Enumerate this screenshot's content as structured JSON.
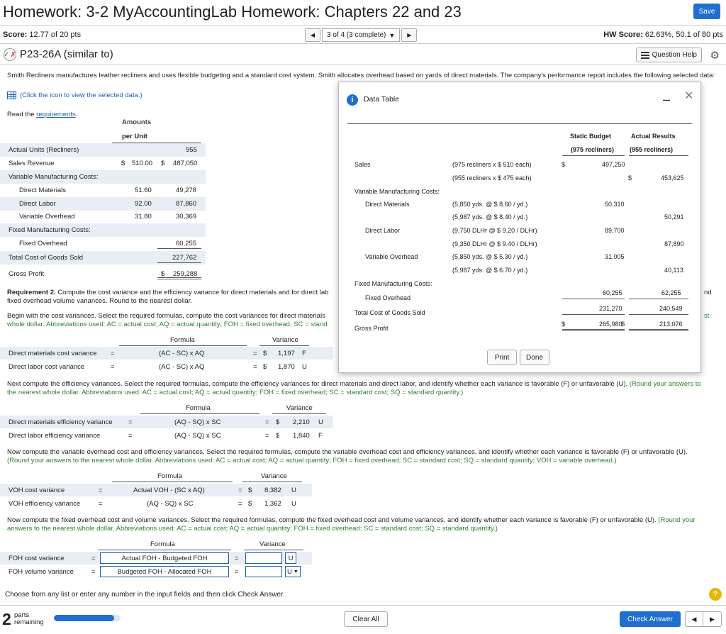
{
  "header": {
    "title": "Homework: 3-2 MyAccountingLab Homework: Chapters 22 and 23",
    "save_label": "Save",
    "score_label": "Score:",
    "score_value": "12.77 of 20 pts",
    "nav_position": "3 of 4 (3 complete)",
    "hw_score_label": "HW Score:",
    "hw_score_value": "62.63%, 50.1 of 80 pts"
  },
  "question": {
    "title": "P23-26A (similar to)",
    "help_label": "Question Help",
    "intro": "Smith Recliners manufactures leather recliners and uses flexible budgeting and a standard cost system. Smith allocates overhead based on yards of direct materials. The company's performance report includes the following selected data:",
    "click_icon_text": "(Click the icon to view the selected data.)",
    "read_prefix": "Read the ",
    "read_link": "requirements",
    "read_suffix": "."
  },
  "left_table": {
    "header1": "Amounts",
    "header2": "per Unit",
    "rows": [
      {
        "label": "Actual Units (Recliners)",
        "per_unit": "",
        "amount": "955"
      },
      {
        "label": "Sales Revenue",
        "per_unit": "$    510.00",
        "amount": "$    487,050"
      },
      {
        "label": "Variable Manufacturing Costs:",
        "per_unit": "",
        "amount": ""
      },
      {
        "label": "Direct Materials",
        "per_unit": "51.60",
        "amount": "49,278"
      },
      {
        "label": "Direct Labor",
        "per_unit": "92.00",
        "amount": "87,860"
      },
      {
        "label": "Variable Overhead",
        "per_unit": "31.80",
        "amount": "30,369"
      },
      {
        "label": "Fixed Manufacturing Costs:",
        "per_unit": "",
        "amount": ""
      },
      {
        "label": "Fixed Overhead",
        "per_unit": "",
        "amount": "60,255"
      },
      {
        "label": "Total Cost of Goods Sold",
        "per_unit": "",
        "amount": "227,762"
      },
      {
        "label": "Gross Profit",
        "per_unit": "",
        "amount": "$    259,288"
      }
    ]
  },
  "requirement": {
    "req_bold": "Requirement 2.",
    "req_line1": " Compute the cost variance and the efficiency variance for direct materials and for direct lab",
    "req_line1_tail": "nd",
    "req_line2": "fixed overhead volume variances. Round to the nearest dollar.",
    "cost_intro1": "Begin with the cost variances. Select the required formulas, compute the cost variances for direct materials",
    "cost_intro1_tail": "st",
    "cost_intro2": "whole dollar. Abbreviations used: AC = actual cost; AQ = actual quantity; FOH = fixed overhead; SC = stand",
    "formula_hdr": "Formula",
    "variance_hdr": "Variance",
    "eq": "=",
    "dollar": "$",
    "cost_rows": [
      {
        "label": "Direct materials cost variance",
        "formula": "(AC - SC) x AQ",
        "value": "1,197",
        "fu": "F"
      },
      {
        "label": "Direct labor cost variance",
        "formula": "(AC - SC) x AQ",
        "value": "1,870",
        "fu": "U"
      }
    ],
    "eff_intro1": "Next compute the efficiency variances. Select the required formulas, compute the efficiency variances for direct materials and direct labor, and identify whether each variance is favorable (F) or unfavorable (U).",
    "eff_intro1_green": " (Round your answers to",
    "eff_intro2": "the nearest whole dollar. Abbreviations used: AC = actual cost; AQ = actual quantity; FOH = fixed overhead; SC = standard cost; SQ = standard quantity.)",
    "eff_rows": [
      {
        "label": "Direct materials efficiency variance",
        "formula": "(AQ - SQ) x SC",
        "value": "2,210",
        "fu": "U"
      },
      {
        "label": "Direct labor efficiency variance",
        "formula": "(AQ - SQ) x SC",
        "value": "1,840",
        "fu": "F"
      }
    ],
    "voh_intro1": "Now compute the variable overhead cost and efficiency variances. Select the required formulas, compute the variable overhead cost and efficiency variances, and identify whether each variance is favorable (F) or unfavorable (U).",
    "voh_intro2": "(Round your answers to the nearest whole dollar. Abbreviations used: AC = actual cost; AQ = actual quantity; FOH = fixed overhead; SC = standard cost; SQ = standard quantity; VOH = variable overhead.)",
    "voh_rows": [
      {
        "label": "VOH cost variance",
        "formula": "Actual VOH - (SC x AQ)",
        "value": "8,382",
        "fu": "U"
      },
      {
        "label": "VOH efficiency variance",
        "formula": "(AQ - SQ) x SC",
        "value": "1,362",
        "fu": "U"
      }
    ],
    "foh_intro1": "Now compute the fixed overhead cost and volume variances. Select the required formulas, compute the fixed overhead cost and volume variances, and identify whether each variance is favorable (F) or unfavorable (U).",
    "foh_intro1_green": " (Round your",
    "foh_intro2": "answers to the nearest whole dollar. Abbreviations used: AC = actual cost; AQ = actual quantity; FOH = fixed overhead; SC = standard cost; SQ = standard quantity.)",
    "foh_rows": [
      {
        "label": "FOH cost variance",
        "formula": "Actual FOH - Budgeted FOH",
        "value": "",
        "fu": "U"
      },
      {
        "label": "FOH volume variance",
        "formula": "Budgeted FOH - Allocated FOH",
        "value": "",
        "fu": "U"
      }
    ]
  },
  "modal": {
    "title": "Data Table",
    "minimize": "–",
    "close": "✕",
    "col_static": "Static Budget",
    "col_static_sub": "(975 recliners)",
    "col_actual": "Actual Results",
    "col_actual_sub": "(955 recliners)",
    "sales_label": "Sales",
    "sales_static_desc": "(975 recliners x  $   510 each)",
    "sales_static_dollar": "$",
    "sales_static_val": "497,250",
    "sales_actual_desc": "(955 recliners x  $   475 each)",
    "sales_actual_dollar": "$",
    "sales_actual_val": "453,625",
    "vmc_label": "Variable Manufacturing Costs:",
    "dm_label": "Direct Materials",
    "dm_static_desc": "(5,850 yds. @  $  8.60 / yd.)",
    "dm_static_val": "50,310",
    "dm_actual_desc": "(5,987 yds. @  $  8.40 / yd.)",
    "dm_actual_val": "50,291",
    "dl_label": "Direct Labor",
    "dl_static_desc": "(9,750 DLHr @  $  9.20 / DLHr)",
    "dl_static_val": "89,700",
    "dl_actual_desc": "(9,350 DLHr @  $  9.40 / DLHr)",
    "dl_actual_val": "87,890",
    "vo_label": "Variable Overhead",
    "vo_static_desc": "(5,850 yds. @  $  5.30 / yd.)",
    "vo_static_val": "31,005",
    "vo_actual_desc": "(5,987 yds. @  $  6.70 / yd.)",
    "vo_actual_val": "40,113",
    "fmc_label": "Fixed Manufacturing Costs:",
    "fo_label": "Fixed Overhead",
    "fo_static_val": "60,255",
    "fo_actual_val": "62,255",
    "tcgs_label": "Total Cost of Goods Sold",
    "tcgs_static_val": "231,270",
    "tcgs_actual_val": "240,549",
    "gp_label": "Gross Profit",
    "gp_static_dollar": "$",
    "gp_static_val": "265,980",
    "gp_actual_dollar": "$",
    "gp_actual_val": "213,076",
    "print_label": "Print",
    "done_label": "Done"
  },
  "footer": {
    "choose_text": "Choose from any list or enter any number in the input fields and then click Check Answer.",
    "parts_num": "2",
    "parts_text1": "parts",
    "parts_text2": "remaining",
    "progress": 0.9,
    "clear_label": "Clear All",
    "check_label": "Check Answer"
  },
  "icons": [
    "save-icon",
    "prev-arrow-icon",
    "next-arrow-icon",
    "partial-credit-icon",
    "question-help-icon",
    "gear-icon",
    "data-grid-icon",
    "info-icon",
    "minimize-icon",
    "close-icon",
    "help-icon"
  ],
  "colors": {
    "accent": "#1f6fd1",
    "green_text": "#2e7d32",
    "link": "#1a5fb4"
  }
}
